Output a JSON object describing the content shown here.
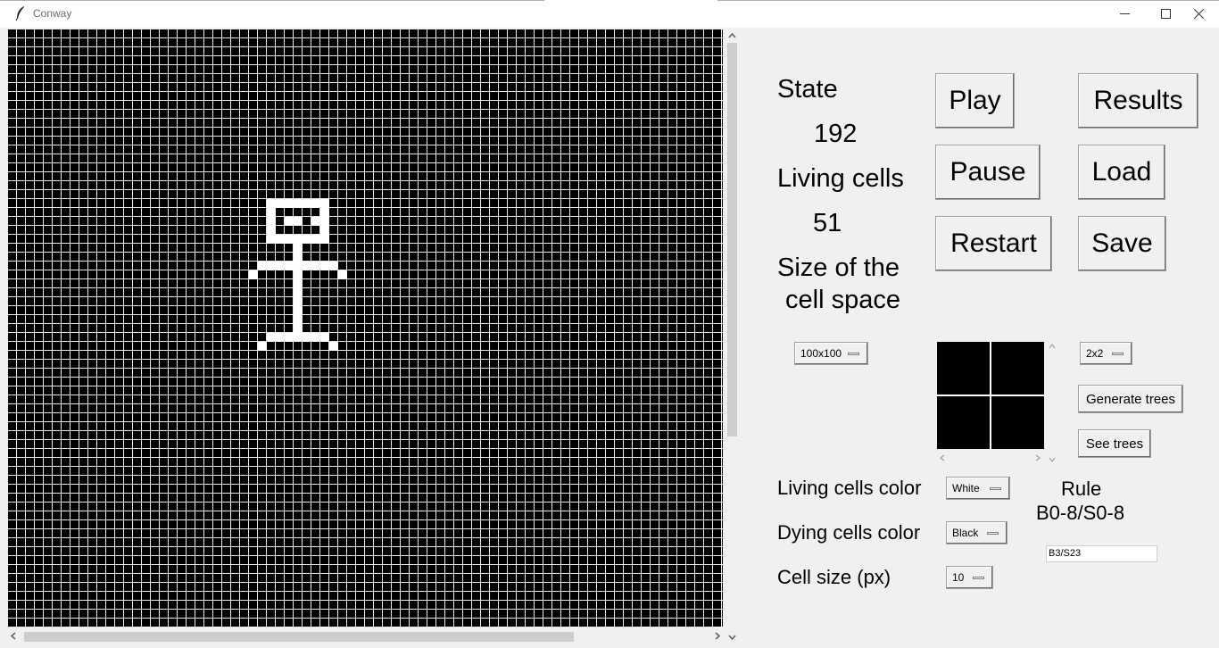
{
  "window": {
    "title": "Conway"
  },
  "grid": {
    "background_color": "#000000",
    "cell_color": "#ffffff",
    "pattern_cells": [
      [
        29,
        19
      ],
      [
        30,
        19
      ],
      [
        31,
        19
      ],
      [
        32,
        19
      ],
      [
        33,
        19
      ],
      [
        34,
        19
      ],
      [
        35,
        19
      ],
      [
        29,
        20
      ],
      [
        35,
        20
      ],
      [
        29,
        21
      ],
      [
        31,
        21
      ],
      [
        32,
        21
      ],
      [
        34,
        21
      ],
      [
        35,
        21
      ],
      [
        29,
        22
      ],
      [
        35,
        22
      ],
      [
        29,
        23
      ],
      [
        30,
        23
      ],
      [
        31,
        23
      ],
      [
        32,
        23
      ],
      [
        33,
        23
      ],
      [
        34,
        23
      ],
      [
        35,
        23
      ],
      [
        32,
        24
      ],
      [
        32,
        25
      ],
      [
        28,
        26
      ],
      [
        29,
        26
      ],
      [
        30,
        26
      ],
      [
        31,
        26
      ],
      [
        32,
        26
      ],
      [
        33,
        26
      ],
      [
        34,
        26
      ],
      [
        35,
        26
      ],
      [
        36,
        26
      ],
      [
        27,
        27
      ],
      [
        32,
        27
      ],
      [
        37,
        27
      ],
      [
        32,
        28
      ],
      [
        32,
        29
      ],
      [
        32,
        30
      ],
      [
        32,
        31
      ],
      [
        32,
        32
      ],
      [
        32,
        33
      ],
      [
        29,
        34
      ],
      [
        30,
        34
      ],
      [
        31,
        34
      ],
      [
        32,
        34
      ],
      [
        33,
        34
      ],
      [
        34,
        34
      ],
      [
        35,
        34
      ],
      [
        28,
        35
      ],
      [
        36,
        35
      ]
    ]
  },
  "stats": {
    "state_label": "State",
    "state_value": "192",
    "living_label": "Living cells",
    "living_value": "51",
    "size_label_line1": "Size of the",
    "size_label_line2": "cell space"
  },
  "buttons": {
    "play": "Play",
    "pause": "Pause",
    "restart": "Restart",
    "results": "Results",
    "load": "Load",
    "save": "Save",
    "generate_trees": "Generate trees",
    "see_trees": "See trees"
  },
  "menus": {
    "cell_space_size": "100x100",
    "tree_size": "2x2",
    "living_color": "White",
    "dying_color": "Black",
    "cell_size": "10"
  },
  "labels": {
    "living_color": "Living cells color",
    "dying_color": "Dying cells color",
    "cell_size": "Cell size (px)",
    "rule_title": "Rule",
    "rule_value": "B0-8/S0-8"
  },
  "rule_input": {
    "value": "B3/S23"
  },
  "icons": {
    "app": "feather-icon",
    "minimize": "minimize-icon",
    "maximize": "maximize-icon",
    "close": "close-icon"
  }
}
